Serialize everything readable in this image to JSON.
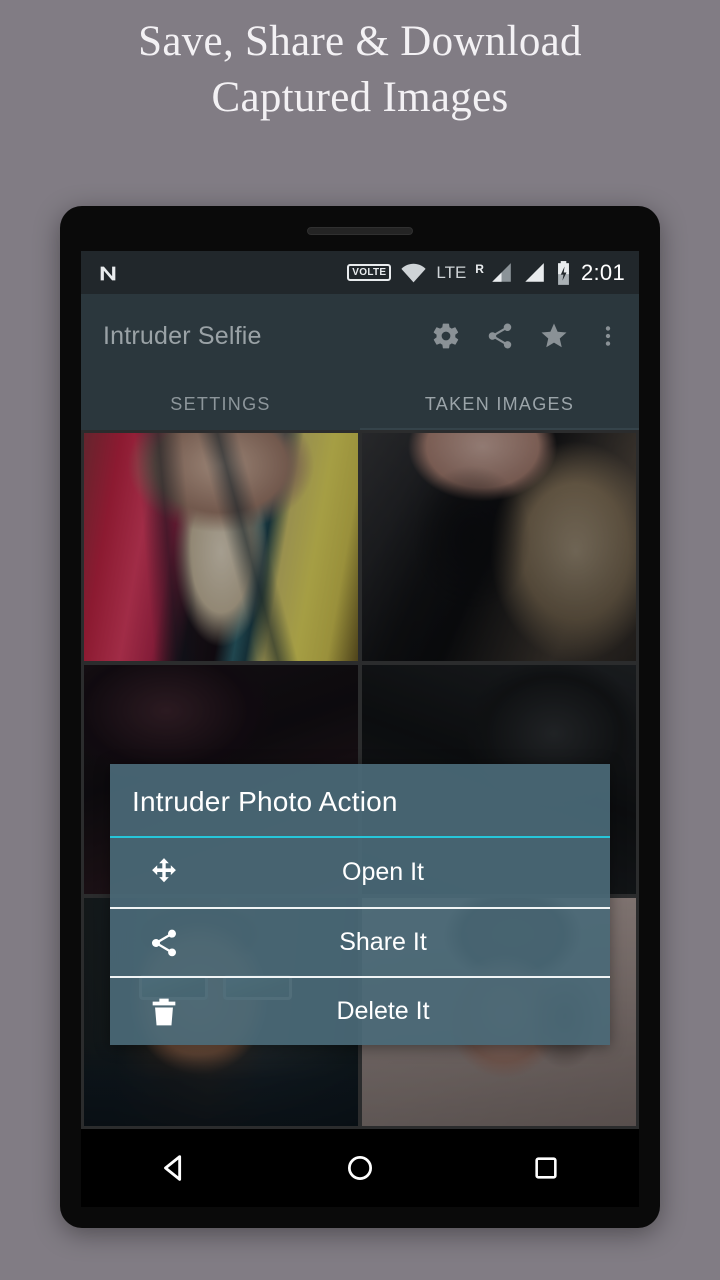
{
  "promo": {
    "line1": "Save, Share & Download",
    "line2": "Captured Images"
  },
  "colors": {
    "page_background": "#817c84",
    "appbar": "#2b373d",
    "statusbar": "#21272b",
    "dialog_background": "#4a6977",
    "dialog_accent": "#26c6da",
    "promo_text": "#f3f1f4",
    "icon_gray": "#8a9196"
  },
  "statusbar": {
    "os_logo": "android-n-logo",
    "volte_badge": "VOLTE",
    "wifi_icon": "wifi-icon",
    "network_type": "LTE",
    "roaming_flag": "R",
    "signal_icon_1": "signal-bars-icon",
    "signal_icon_2": "signal-bars-icon",
    "battery_icon": "battery-charging-icon",
    "time": "2:01"
  },
  "appbar": {
    "title": "Intruder Selfie",
    "actions": [
      {
        "name": "settings-gear-icon",
        "label": "Settings"
      },
      {
        "name": "share-icon",
        "label": "Share"
      },
      {
        "name": "star-icon",
        "label": "Rate"
      },
      {
        "name": "overflow-menu-icon",
        "label": "More options"
      }
    ]
  },
  "tabs": [
    {
      "label": "SETTINGS",
      "active": false
    },
    {
      "label": "TAKEN IMAGES",
      "active": true
    }
  ],
  "gallery": {
    "columns": 2,
    "thumbnails": [
      {
        "id": 1,
        "description": "Woman in pink and yellow traditional outfit"
      },
      {
        "id": 2,
        "description": "Blonde woman in black top"
      },
      {
        "id": 3,
        "description": "Dark intruder photo"
      },
      {
        "id": 4,
        "description": "Dark intruder photo"
      },
      {
        "id": 5,
        "description": "Man wearing sunglasses in a car"
      },
      {
        "id": 6,
        "description": "Young woman with hair in a bun"
      }
    ]
  },
  "dialog": {
    "title": "Intruder Photo Action",
    "items": [
      {
        "label": "Open It",
        "icon": "move-arrows-icon"
      },
      {
        "label": "Share It",
        "icon": "share-icon"
      },
      {
        "label": "Delete It",
        "icon": "trash-icon"
      }
    ]
  },
  "navbar": {
    "back": "back-triangle-icon",
    "home": "home-circle-icon",
    "recents": "recents-square-icon"
  }
}
